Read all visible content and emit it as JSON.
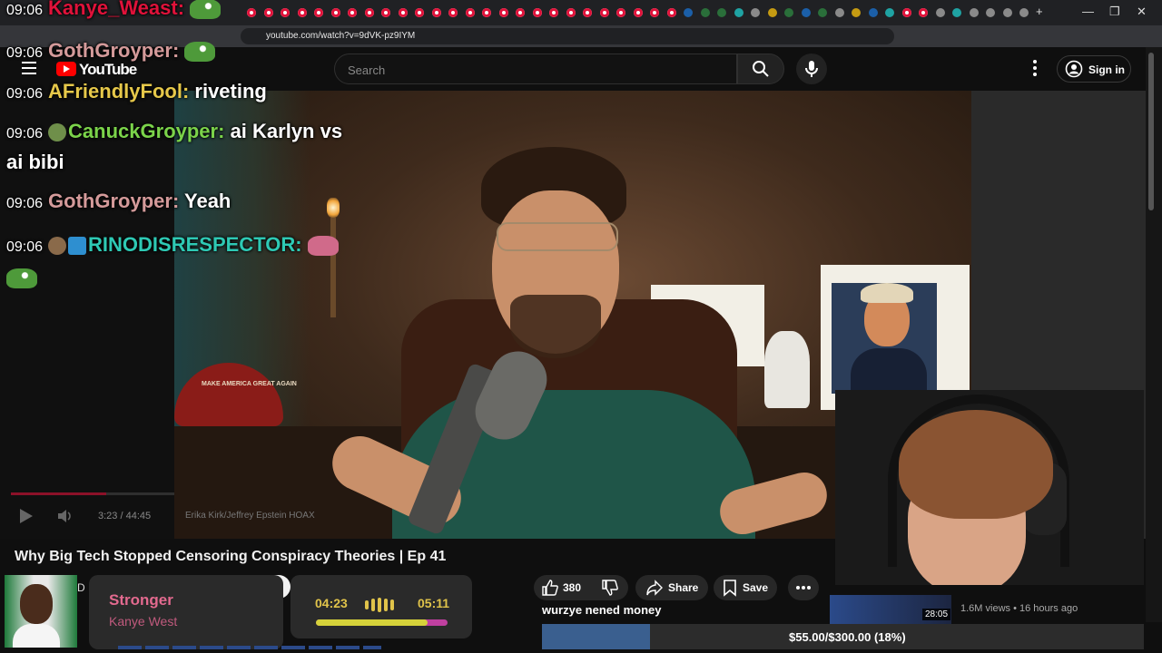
{
  "browser": {
    "url": "youtube.com/watch?v=9dVK-pz9IYM",
    "tab_plus": "+"
  },
  "youtube": {
    "logo_text": "YouTube",
    "search_placeholder": "Search",
    "signin_label": "Sign in"
  },
  "chat": [
    {
      "time": "09:06",
      "user": "Kanye_Weast",
      "color": "#e0123a",
      "text": ""
    },
    {
      "time": "09:06",
      "user": "GothGroyper",
      "color": "#d49a9a",
      "text": ""
    },
    {
      "time": "09:06",
      "user": "AFriendlyFool",
      "color": "#e6c84a",
      "text": "riveting"
    },
    {
      "time": "09:06",
      "user": "CanuckGroyper",
      "color": "#7bd34a",
      "text": "ai Karlyn vs"
    },
    {
      "time": "",
      "user": "",
      "color": "#fff",
      "text": "ai bibi"
    },
    {
      "time": "09:06",
      "user": "GothGroyper",
      "color": "#d49a9a",
      "text": "Yeah"
    },
    {
      "time": "09:06",
      "user": "RINODISRESPECTOR",
      "color": "#2ec9b4",
      "text": ""
    }
  ],
  "video": {
    "hat_text": "MAKE AMERICA GREAT AGAIN",
    "time_display": "3:23 / 44:45",
    "chapter": "Erika Kirk/Jeffrey Epstein HOAX",
    "progress": 0.08,
    "title": "Why Big Tech Stopped Censoring Conspiracy Theories | Ep 41"
  },
  "actions": {
    "like_count": "380",
    "share_label": "Share",
    "save_label": "Save",
    "channel_initial": "D"
  },
  "music": {
    "song": "Stronger",
    "artist": "Kanye West",
    "current": "04:23",
    "total": "05:11",
    "progress": 0.85
  },
  "overlay": {
    "comment": "wurzye nened money",
    "donation": "$55.00/$300.00 (18%)",
    "donation_progress": 0.18
  },
  "recommendation": {
    "duration": "28:05",
    "meta": "1.6M views • 16 hours ago"
  },
  "colors": {
    "yt_red": "#ff0000",
    "accent_pink": "#e36a8f",
    "accent_yellow": "#e0c34a",
    "donation_blue": "#3a5f8f"
  }
}
